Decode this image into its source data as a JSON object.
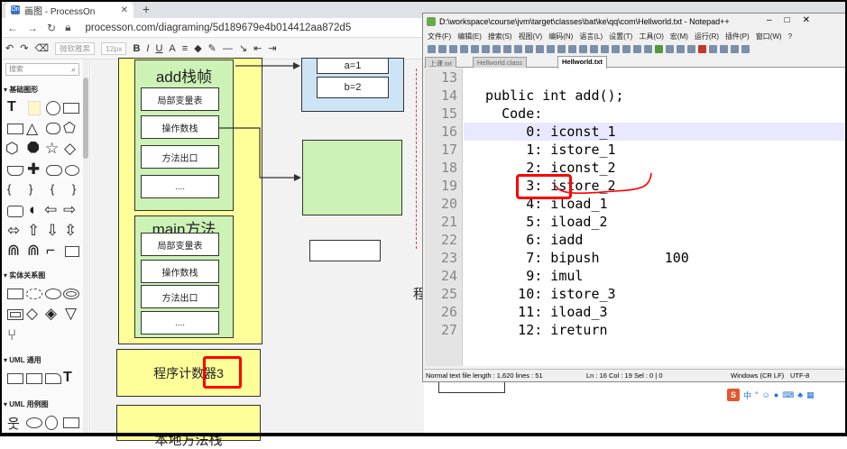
{
  "browser": {
    "tab_title": "画图 - ProcessOn",
    "tab_icon": "On",
    "url": "processon.com/diagraming/5d189679e4b014412aa872d5"
  },
  "po_toolbar": {
    "font_select": "微软雅黑",
    "size_select": "12px",
    "bold": "B",
    "italic": "I",
    "underline": "U",
    "font_color": "A",
    "align": "≡"
  },
  "shapes_panel": {
    "search_placeholder": "搜索",
    "sections": [
      "基础图形",
      "实体关系图",
      "UML 通用",
      "UML 用例图"
    ]
  },
  "canvas": {
    "add_frame_title": "add栈帧",
    "add_slots": [
      "局部变量表",
      "操作数栈",
      "方法出口",
      "...."
    ],
    "main_frame_title": "main方法",
    "main_slots": [
      "局部变量表",
      "操作数栈",
      "方法出口",
      "...."
    ],
    "pc_counter": "程序计数器3",
    "bottom_label": "本地方法栈",
    "var_a": "a=1",
    "var_b": "b=2",
    "side_text": "程"
  },
  "notepad": {
    "title": "D:\\workspace\\course\\jvm\\target\\classes\\bat\\ke\\qq\\com\\Hellworld.txt - Notepad++",
    "menu": [
      "文件(F)",
      "编辑(E)",
      "搜索(S)",
      "视图(V)",
      "编码(N)",
      "语言(L)",
      "设置(T)",
      "工具(O)",
      "宏(M)",
      "运行(R)",
      "插件(P)",
      "窗口(W)",
      "?"
    ],
    "tabs": [
      "上课.txt",
      "Hellworld.class",
      "Hellworld.txt"
    ],
    "active_tab": "Hellworld.txt",
    "lines": [
      {
        "num": "13",
        "code": ""
      },
      {
        "num": "14",
        "code": "  public int add();"
      },
      {
        "num": "15",
        "code": "    Code:"
      },
      {
        "num": "16",
        "code": "       0: iconst_1"
      },
      {
        "num": "17",
        "code": "       1: istore_1"
      },
      {
        "num": "18",
        "code": "       2: iconst_2"
      },
      {
        "num": "19",
        "code": "       3: istore_2"
      },
      {
        "num": "20",
        "code": "       4: iload_1"
      },
      {
        "num": "21",
        "code": "       5: iload_2"
      },
      {
        "num": "22",
        "code": "       6: iadd"
      },
      {
        "num": "23",
        "code": "       7: bipush        100"
      },
      {
        "num": "24",
        "code": "       9: imul"
      },
      {
        "num": "25",
        "code": "      10: istore_3"
      },
      {
        "num": "26",
        "code": "      11: iload_3"
      },
      {
        "num": "27",
        "code": "      12: ireturn"
      }
    ],
    "status": {
      "file_info": "Normal text file length : 1,620    lines : 51",
      "position": "Ln : 16    Col : 19    Sel : 0 | 0",
      "eol": "Windows (CR LF)",
      "encoding": "UTF-8"
    }
  },
  "ime": {
    "logo": "S",
    "mode": "中"
  },
  "colors": {
    "frame_yellow": "#ffff99",
    "frame_green": "#ccf2b5",
    "var_blue": "#cde4f7",
    "annotation_red": "#ff0000",
    "current_line": "#e8e8ff"
  }
}
